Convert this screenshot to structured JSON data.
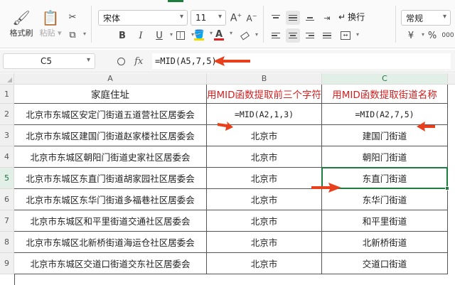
{
  "ribbon": {
    "format_painter": "格式刷",
    "paste": "粘贴",
    "font_name": "宋体",
    "font_size": "11",
    "bold": "B",
    "italic": "I",
    "underline": "U",
    "wrap_text": "换行",
    "number_format": "常规",
    "grow_font": "A",
    "shrink_font": "A",
    "font_color_letter": "A",
    "currency": "¥",
    "percent": "%",
    "thousands": "000",
    "accent_green": "#1e7d3c",
    "font_color": "#e02020",
    "fill_color": "#f2d600"
  },
  "formula_bar": {
    "cell_ref": "C5",
    "fx": "fx",
    "formula": "=MID(A5,7,5)"
  },
  "columns": [
    "A",
    "B",
    "C"
  ],
  "rows": [
    "1",
    "2",
    "3",
    "4",
    "5",
    "6",
    "7",
    "8",
    "9"
  ],
  "table": {
    "header": [
      "家庭住址",
      "用MID函数提取前三个字符",
      "用MID函数提取街道名称"
    ],
    "formulas": [
      "北京市东城区安定门街道五道营社区居委会",
      "=MID(A2,1,3)",
      "=MID(A2,7,5)"
    ],
    "data": [
      [
        "北京市东城区建国门街道赵家楼社区居委会",
        "北京市",
        "建国门街道"
      ],
      [
        "北京市东城区朝阳门街道史家社区居委会",
        "北京市",
        "朝阳门街道"
      ],
      [
        "北京市东城区东直门街道胡家园社区居委会",
        "北京市",
        "东直门街道"
      ],
      [
        "北京市东城区东华门街道多福巷社区居委会",
        "北京市",
        "东华门街道"
      ],
      [
        "北京市东城区和平里街道交通社区居委会",
        "北京市",
        "和平里街道"
      ],
      [
        "北京市东城区北新桥街道海运仓社区居委会",
        "北京市",
        "北新桥街道"
      ],
      [
        "北京市东城区交道口街道交东社区居委会",
        "北京市",
        "交道口街道"
      ]
    ]
  },
  "annotation_color": "#e8401c"
}
